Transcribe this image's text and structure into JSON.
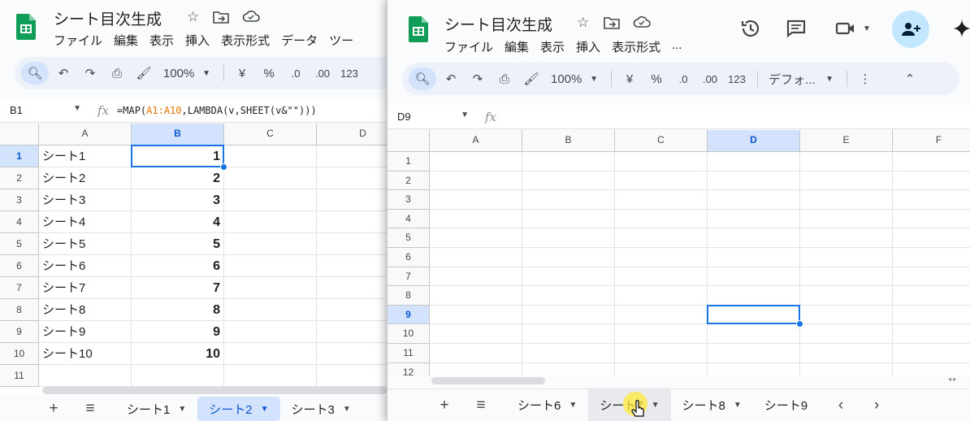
{
  "colors": {
    "brand_green": "#0f9d58",
    "selection": "#1a73e8",
    "header_selected": "#d3e3fd",
    "formula_range": "#e37400",
    "tab_active_text": "#0b57d0"
  },
  "left": {
    "doc_title": "シート目次生成",
    "menu": [
      "ファイル",
      "編集",
      "表示",
      "挿入",
      "表示形式",
      "データ",
      "ツー"
    ],
    "toolbar": {
      "zoom": "100%",
      "currency": "¥",
      "percent": "%",
      "dec_less": ".0",
      "dec_more": ".00",
      "number_format": "123"
    },
    "name_box": "B1",
    "formula": {
      "prefix": "=MAP(",
      "range": "A1:A10",
      "suffix": ",LAMBDA(v,SHEET(v&\"\")))"
    },
    "columns": [
      "A",
      "B",
      "C",
      "D"
    ],
    "rows": [
      {
        "num": "1",
        "a": "シート1",
        "b": "1"
      },
      {
        "num": "2",
        "a": "シート2",
        "b": "2"
      },
      {
        "num": "3",
        "a": "シート3",
        "b": "3"
      },
      {
        "num": "4",
        "a": "シート4",
        "b": "4"
      },
      {
        "num": "5",
        "a": "シート5",
        "b": "5"
      },
      {
        "num": "6",
        "a": "シート6",
        "b": "6"
      },
      {
        "num": "7",
        "a": "シート7",
        "b": "7"
      },
      {
        "num": "8",
        "a": "シート8",
        "b": "8"
      },
      {
        "num": "9",
        "a": "シート9",
        "b": "9"
      },
      {
        "num": "10",
        "a": "シート10",
        "b": "10"
      },
      {
        "num": "11",
        "a": "",
        "b": ""
      }
    ],
    "tabs": [
      {
        "label": "シート1"
      },
      {
        "label": "シート2"
      },
      {
        "label": "シート3"
      }
    ],
    "active_tab": "シート2",
    "selected_column": "B",
    "selected_row": "1"
  },
  "right": {
    "doc_title": "シート目次生成",
    "menu": [
      "ファイル",
      "編集",
      "表示",
      "挿入",
      "表示形式",
      "..."
    ],
    "toolbar": {
      "zoom": "100%",
      "currency": "¥",
      "percent": "%",
      "dec_less": ".0",
      "dec_more": ".00",
      "number_format": "123",
      "font": "デフォ..."
    },
    "name_box": "D9",
    "formula": "",
    "columns": [
      "A",
      "B",
      "C",
      "D",
      "E",
      "F"
    ],
    "rows": [
      "1",
      "2",
      "3",
      "4",
      "5",
      "6",
      "7",
      "8",
      "9",
      "10",
      "11",
      "12"
    ],
    "tabs": [
      {
        "label": "シート6"
      },
      {
        "label": "シート7"
      },
      {
        "label": "シート8"
      },
      {
        "label": "シート9"
      }
    ],
    "hovered_tab": "シート7",
    "selected_column": "D",
    "selected_row": "9"
  }
}
